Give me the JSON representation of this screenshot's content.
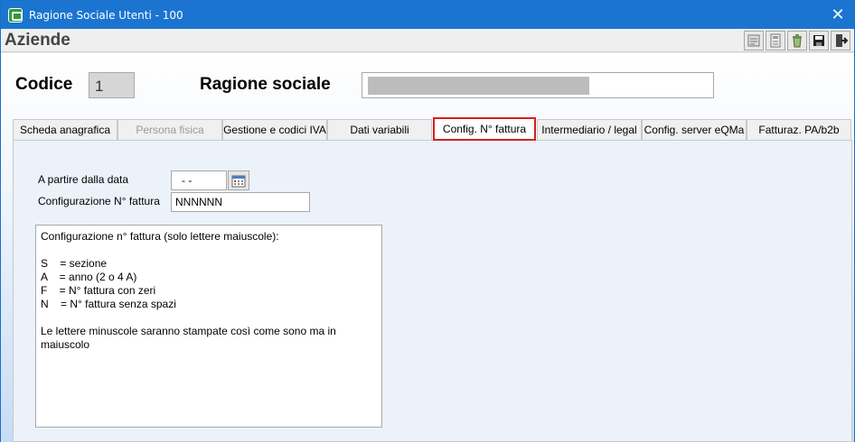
{
  "window": {
    "title": "Ragione Sociale Utenti - 100",
    "close_glyph": "✕"
  },
  "header": {
    "section_title": "Aziende",
    "toolbar": [
      {
        "icon": "report-icon"
      },
      {
        "icon": "print-preview-icon"
      },
      {
        "icon": "recycle-icon"
      },
      {
        "icon": "save-icon"
      },
      {
        "icon": "exit-icon"
      }
    ]
  },
  "form": {
    "codice_label": "Codice",
    "codice_value": "1",
    "ragione_label": "Ragione sociale",
    "ragione_value": ""
  },
  "tabs": [
    {
      "label": "Scheda anagrafica",
      "state": "normal"
    },
    {
      "label": "Persona fisica",
      "state": "disabled"
    },
    {
      "label": "Gestione e codici IVA",
      "state": "normal"
    },
    {
      "label": "Dati variabili",
      "state": "normal"
    },
    {
      "label": "Config. N° fattura",
      "state": "active"
    },
    {
      "label": "Intermediario / legal",
      "state": "normal"
    },
    {
      "label": "Config. server eQMa",
      "state": "normal"
    },
    {
      "label": "Fatturaz. PA/b2b",
      "state": "normal"
    }
  ],
  "panel": {
    "date_label": "A partire dalla data",
    "date_value": "- -",
    "config_label": "Configurazione N° fattura",
    "config_value": "NNNNNN",
    "notes": "Configurazione n° fattura (solo lettere maiuscole):\n\nS    = sezione\nA    = anno (2 o 4 A)\nF    = N° fattura con zeri\nN    = N° fattura senza spazi\n\nLe lettere minuscole saranno stampate così come sono ma in\nmaiuscolo"
  },
  "colors": {
    "titlebar": "#1b75d0",
    "active_tab_border": "#d51f1f",
    "panel_bg": "#ecf2fa"
  }
}
